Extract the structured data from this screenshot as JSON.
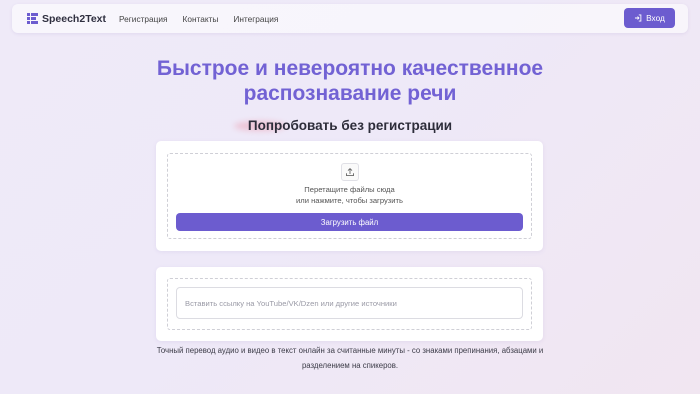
{
  "header": {
    "brand": "Speech2Text",
    "logo_icon": "bar-chart-logo-icon",
    "nav": [
      "Регистрация",
      "Контакты",
      "Интеграция"
    ],
    "login_label": "Вход",
    "login_icon": "sign-in-icon",
    "accent_color": "#6c5ccf"
  },
  "hero": {
    "title_line1": "Быстрое и невероятно качественное",
    "title_line2": "распознавание речи",
    "title_color": "#7262d4",
    "subtitle": "Попробовать без регистрации"
  },
  "upload": {
    "icon": "upload-icon",
    "hint_line1": "Перетащите файлы сюда",
    "hint_line2": "или нажмите, чтобы загрузить",
    "button_label": "Загрузить файл"
  },
  "link": {
    "value": "",
    "placeholder": "Вставить ссылку на YouTube/VK/Dzen или другие источники"
  },
  "footer": {
    "line1": "Точный перевод аудио и видео в текст онлайн за считанные минуты - со знаками препинания, абзацами и",
    "line2": "разделением на спикеров."
  }
}
